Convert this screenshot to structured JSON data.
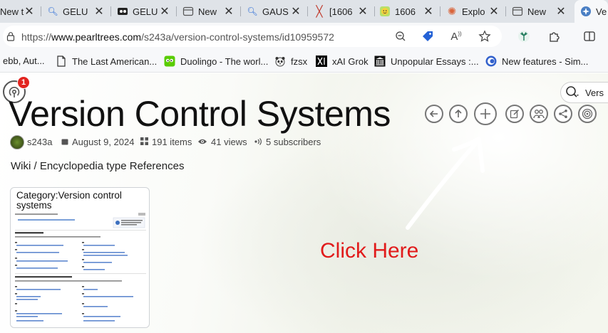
{
  "tabs": [
    {
      "title": "New t",
      "icon": "tab-icon",
      "active": false
    },
    {
      "title": "GELU",
      "icon": "search-icon",
      "active": false
    },
    {
      "title": "GELU",
      "icon": "video-icon",
      "active": false
    },
    {
      "title": "New",
      "icon": "tab-icon",
      "active": false
    },
    {
      "title": "GAUS",
      "icon": "search-icon",
      "active": false
    },
    {
      "title": "[1606",
      "icon": "x-logo-icon",
      "active": false
    },
    {
      "title": "1606",
      "icon": "smiley-icon",
      "active": false
    },
    {
      "title": "Explo",
      "icon": "claude-icon",
      "active": false
    },
    {
      "title": "New",
      "icon": "tab-icon",
      "active": false
    },
    {
      "title": "Ve",
      "icon": "pearltrees-icon",
      "active": true
    }
  ],
  "address": {
    "url_prefix": "https://",
    "url_host": "www.pearltrees.com",
    "url_path": "/s243a/version-control-systems/id10959572"
  },
  "bookmarks": [
    {
      "label": "ebb, Aut...",
      "icon": "bookmark-icon"
    },
    {
      "label": "The Last American...",
      "icon": "document-icon"
    },
    {
      "label": "Duolingo - The worl...",
      "icon": "duolingo-icon"
    },
    {
      "label": "fzsx",
      "icon": "panda-icon"
    },
    {
      "label": "xAI Grok",
      "icon": "xai-icon"
    },
    {
      "label": "Unpopular Essays :...",
      "icon": "building-icon"
    },
    {
      "label": "New features - Sim...",
      "icon": "simplenote-icon"
    }
  ],
  "page": {
    "notification_count": "1",
    "search_text": "Vers",
    "title": "Version Control Systems",
    "meta": {
      "author": "s243a",
      "date": "August 9, 2024",
      "items": "191 items",
      "views": "41 views",
      "subscribers": "5 subscribers"
    },
    "description": "Wiki / Encyclopedia type References",
    "card": {
      "title": "Category:Version control systems"
    },
    "annotation": "Click Here",
    "colors": {
      "annotation": "#e11b1b",
      "badge": "#e2241f"
    }
  }
}
